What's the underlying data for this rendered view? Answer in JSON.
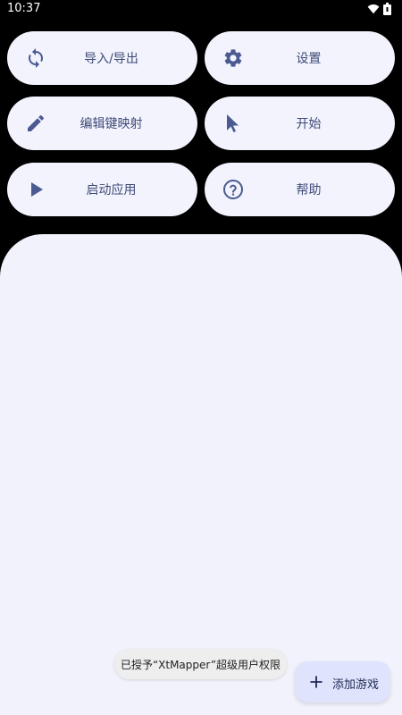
{
  "status": {
    "time": "10:37",
    "icons": [
      "wifi-icon",
      "battery-icon"
    ]
  },
  "actions": [
    {
      "label": "导入/导出",
      "icon": "sync-icon"
    },
    {
      "label": "设置",
      "icon": "gear-icon"
    },
    {
      "label": "编辑键映射",
      "icon": "pencil-icon"
    },
    {
      "label": "开始",
      "icon": "cursor-icon"
    },
    {
      "label": "启动应用",
      "icon": "play-icon"
    },
    {
      "label": "帮助",
      "icon": "help-icon"
    }
  ],
  "toast": {
    "text": "已授予“XtMapper”超级用户权限"
  },
  "fab": {
    "label": "添加游戏",
    "icon": "plus-icon"
  },
  "colors": {
    "background": "#000000",
    "button_bg": "#f2f3fc",
    "button_text": "#3f4b78",
    "panel_bg": "#f1f2fb",
    "fab_bg": "#dfe3fb"
  }
}
